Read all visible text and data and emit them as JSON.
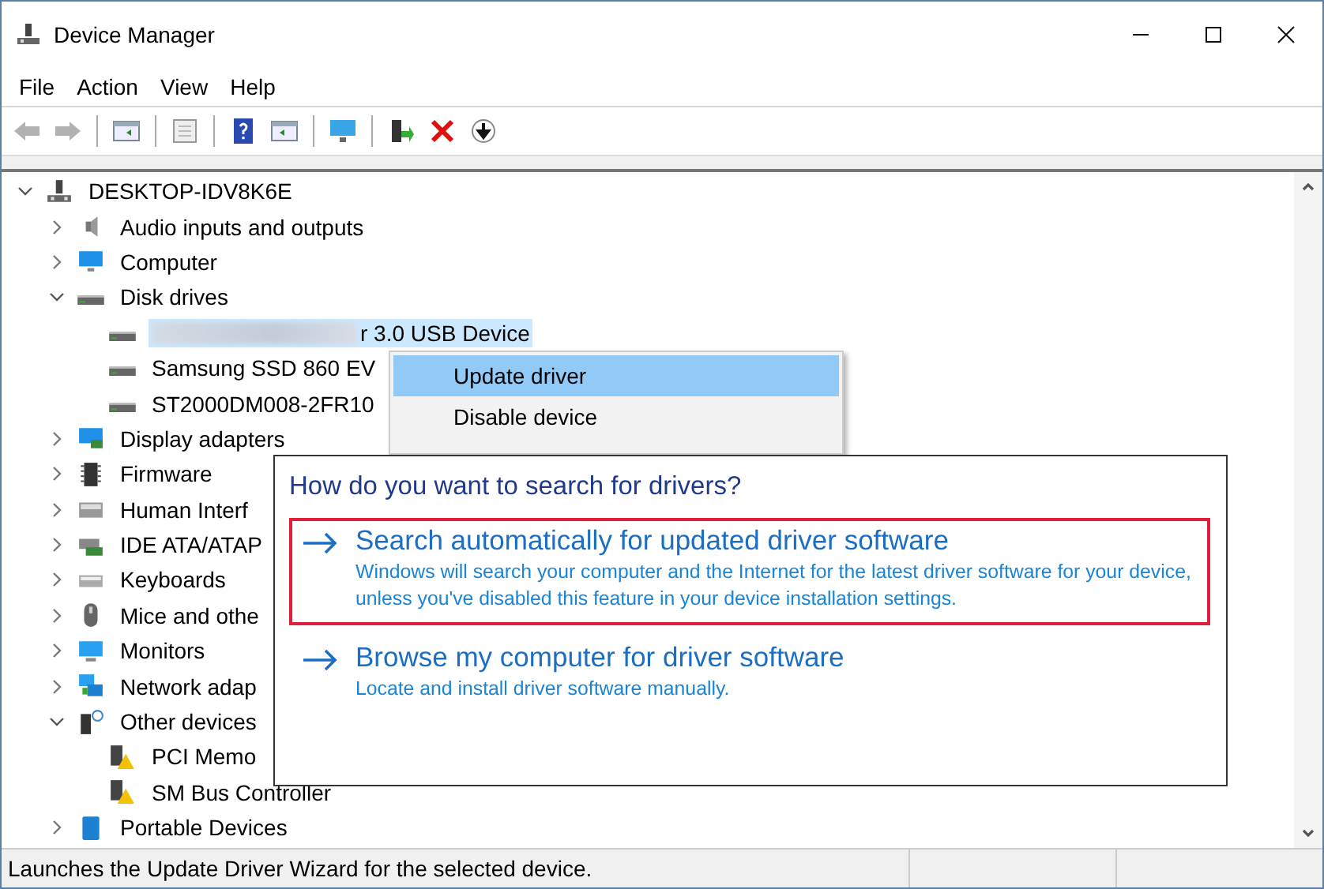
{
  "window": {
    "title": "Device Manager"
  },
  "menu": [
    {
      "label": "File"
    },
    {
      "label": "Action"
    },
    {
      "label": "View"
    },
    {
      "label": "Help"
    }
  ],
  "toolbar": [
    {
      "kind": "back",
      "disabled": true
    },
    {
      "kind": "forward",
      "disabled": true
    },
    {
      "kind": "separator"
    },
    {
      "kind": "pane-left",
      "disabled": false
    },
    {
      "kind": "separator"
    },
    {
      "kind": "sheet",
      "disabled": false
    },
    {
      "kind": "separator"
    },
    {
      "kind": "help",
      "disabled": false
    },
    {
      "kind": "pane-right",
      "disabled": false
    },
    {
      "kind": "separator"
    },
    {
      "kind": "monitor",
      "disabled": false
    },
    {
      "kind": "separator"
    },
    {
      "kind": "driver",
      "disabled": false
    },
    {
      "kind": "remove",
      "disabled": false
    },
    {
      "kind": "download",
      "disabled": false
    }
  ],
  "tree": [
    {
      "label": "DESKTOP-IDV8K6E",
      "kind": "root",
      "expanded": true,
      "selected": false,
      "children": [
        {
          "label": "Audio inputs and outputs",
          "kind": "audio",
          "expanded": false,
          "selected": false
        },
        {
          "label": "Computer",
          "kind": "computer",
          "expanded": false,
          "selected": false
        },
        {
          "label": "Disk drives",
          "kind": "disk",
          "expanded": true,
          "selected": false,
          "children": [
            {
              "label": "r 3.0 USB Device",
              "kind": "disk",
              "blurred": true,
              "selected": true
            },
            {
              "label": "Samsung SSD 860 EV",
              "kind": "disk",
              "blurred": false,
              "selected": false
            },
            {
              "label": "ST2000DM008-2FR10",
              "kind": "disk",
              "blurred": false,
              "selected": false
            }
          ]
        },
        {
          "label": "Display adapters",
          "kind": "display",
          "expanded": false,
          "selected": false
        },
        {
          "label": "Firmware",
          "kind": "firmware",
          "expanded": false,
          "selected": false
        },
        {
          "label": "Human Interf",
          "kind": "hid",
          "expanded": false,
          "selected": false
        },
        {
          "label": "IDE ATA/ATAP",
          "kind": "ide",
          "expanded": false,
          "selected": false
        },
        {
          "label": "Keyboards",
          "kind": "keyboard",
          "expanded": false,
          "selected": false
        },
        {
          "label": "Mice and othe",
          "kind": "mouse",
          "expanded": false,
          "selected": false
        },
        {
          "label": "Monitors",
          "kind": "monitor",
          "expanded": false,
          "selected": false
        },
        {
          "label": "Network adap",
          "kind": "network",
          "expanded": false,
          "selected": false
        },
        {
          "label": "Other devices",
          "kind": "other",
          "expanded": true,
          "selected": false,
          "children": [
            {
              "label": "PCI Memo",
              "kind": "warning",
              "selected": false
            },
            {
              "label": "SM Bus Controller",
              "kind": "warning",
              "selected": false
            }
          ]
        },
        {
          "label": "Portable Devices",
          "kind": "portable",
          "expanded": false,
          "selected": false
        }
      ]
    }
  ],
  "context_menu": [
    {
      "label": "Update driver",
      "selected": true
    },
    {
      "label": "Disable device",
      "selected": false
    }
  ],
  "dialog": {
    "heading": "How do you want to search for drivers?",
    "options": [
      {
        "title": "Search automatically for updated driver software",
        "description": "Windows will search your computer and the Internet for the latest driver software for your device, unless you've disabled this feature in your device installation settings.",
        "outlined": true
      },
      {
        "title": "Browse my computer for driver software",
        "description": "Locate and install driver software manually.",
        "outlined": false
      }
    ]
  },
  "status_bar": {
    "text": "Launches the Update Driver Wizard for the selected device."
  }
}
